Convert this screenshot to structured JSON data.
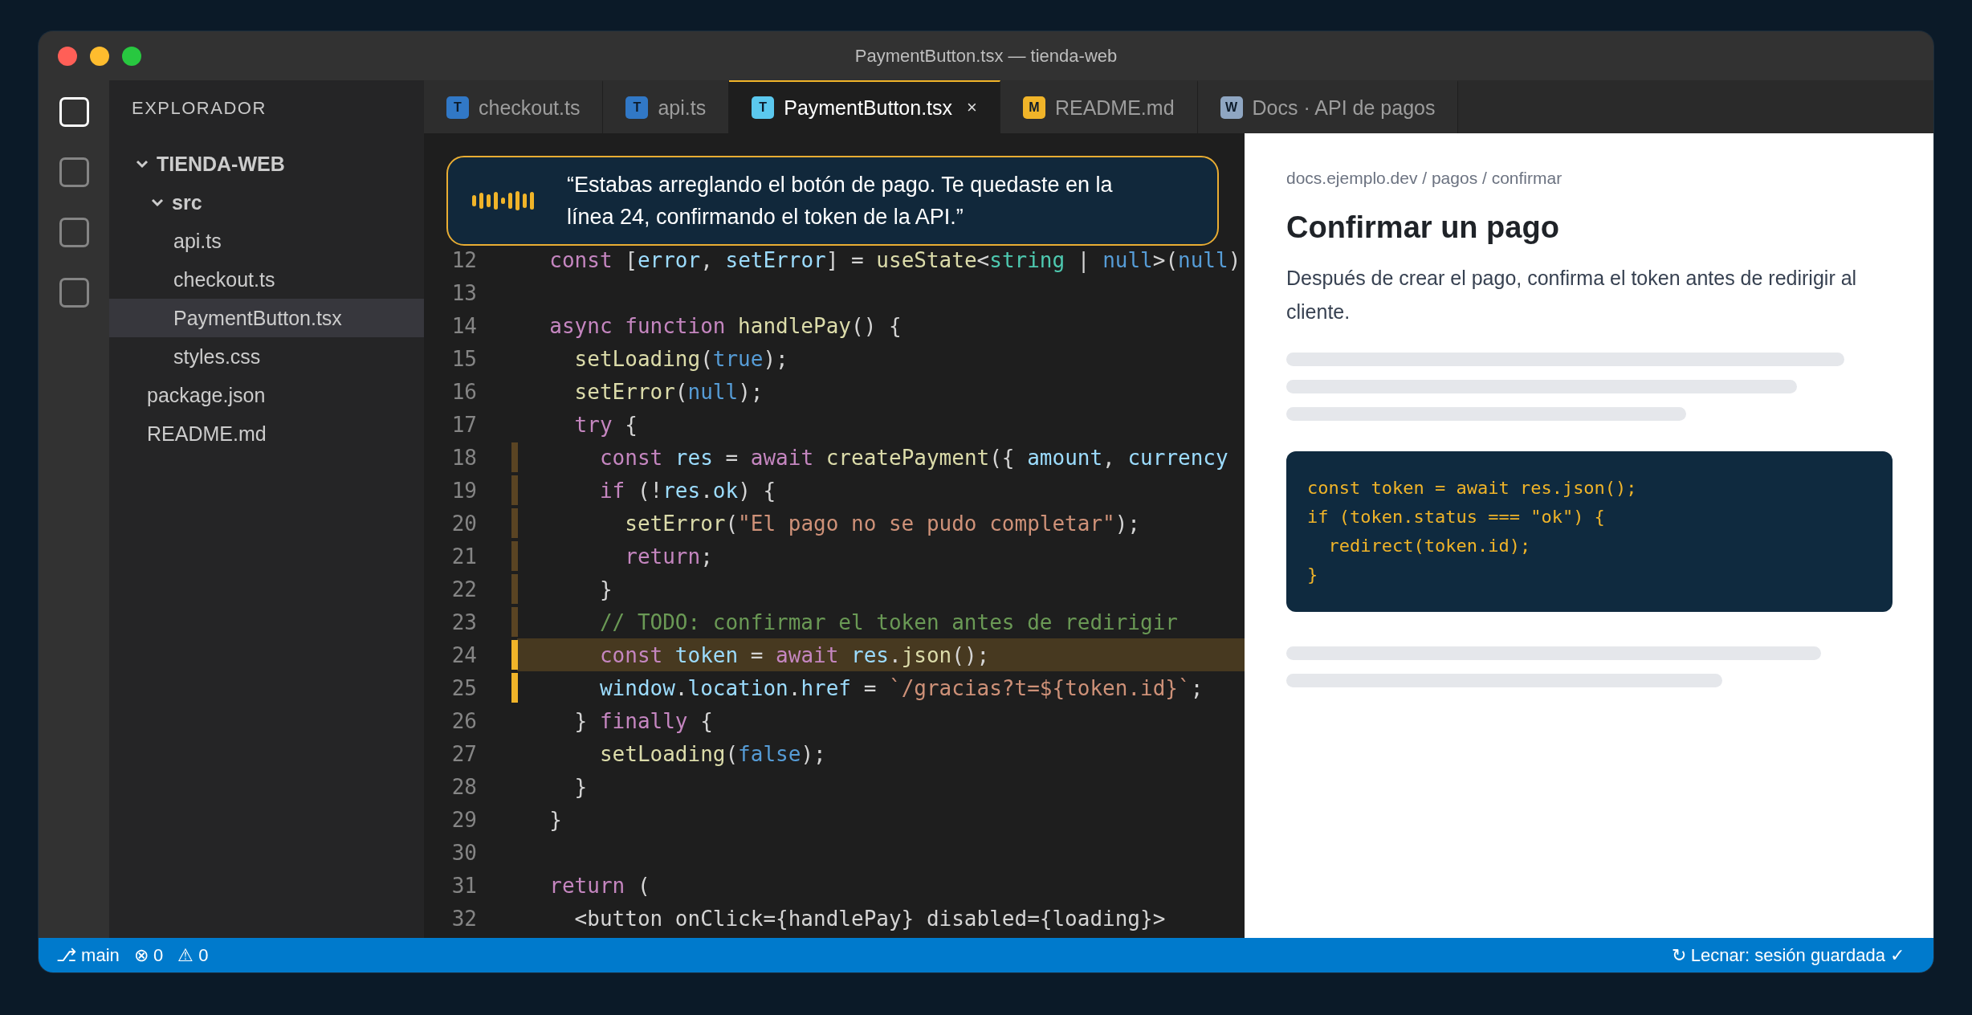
{
  "window": {
    "title": "PaymentButton.tsx — tienda-web"
  },
  "activity_bar": [
    {
      "selected": true
    },
    {
      "selected": false
    },
    {
      "selected": false
    },
    {
      "selected": false
    }
  ],
  "explorer": {
    "title": "EXPLORADOR",
    "tree": [
      {
        "label": "TIENDA-WEB",
        "kind": "folder",
        "expanded": true,
        "selected": false,
        "children": [
          {
            "label": "src",
            "kind": "folder",
            "expanded": true,
            "selected": false,
            "children": [
              {
                "label": "api.ts",
                "kind": "file",
                "selected": false
              },
              {
                "label": "checkout.ts",
                "kind": "file",
                "selected": false
              },
              {
                "label": "PaymentButton.tsx",
                "kind": "file",
                "selected": true
              },
              {
                "label": "styles.css",
                "kind": "file",
                "selected": false
              }
            ]
          },
          {
            "label": "package.json",
            "kind": "file",
            "selected": false
          },
          {
            "label": "README.md",
            "kind": "file",
            "selected": false
          }
        ]
      }
    ]
  },
  "tabs": [
    {
      "badge": "T",
      "color": "#3178c6",
      "label": "checkout.ts",
      "selected": false
    },
    {
      "badge": "T",
      "color": "#3178c6",
      "label": "api.ts",
      "selected": false
    },
    {
      "badge": "T",
      "color": "#5bc8ee",
      "label": "PaymentButton.tsx",
      "selected": true,
      "close": "×"
    },
    {
      "badge": "M",
      "color": "#f0b429",
      "label": "README.md",
      "selected": false
    },
    {
      "badge": "W",
      "color": "#8fa6c2",
      "label": "Docs · API de pagos",
      "selected": false
    }
  ],
  "tooltip": {
    "text": "“Estabas arreglando el botón de pago. Te quedaste en la línea 24, confirmando el token de la API.”"
  },
  "editor": {
    "lines": [
      {
        "number": "12",
        "kind": "plain",
        "highlighted": false,
        "tokens": [
          {
            "text": "  const",
            "kind": "kw"
          },
          {
            "text": " [",
            "kind": "plain"
          },
          {
            "text": "error",
            "kind": "var"
          },
          {
            "text": ", ",
            "kind": "plain"
          },
          {
            "text": "setError",
            "kind": "var"
          },
          {
            "text": "] = ",
            "kind": "plain"
          },
          {
            "text": "useState",
            "kind": "fn"
          },
          {
            "text": "<",
            "kind": "plain"
          },
          {
            "text": "string",
            "kind": "type"
          },
          {
            "text": " | ",
            "kind": "plain"
          },
          {
            "text": "null",
            "kind": "lit"
          },
          {
            "text": ">(",
            "kind": "plain"
          },
          {
            "text": "null",
            "kind": "lit"
          },
          {
            "text": ")",
            "kind": "plain"
          }
        ]
      },
      {
        "number": "13",
        "kind": "plain",
        "highlighted": false
      },
      {
        "number": "14",
        "kind": "plain",
        "highlighted": false,
        "tokens": [
          {
            "text": "  async function",
            "kind": "kw"
          },
          {
            "text": " handlePay",
            "kind": "fn"
          },
          {
            "text": "() {",
            "kind": "plain"
          }
        ]
      },
      {
        "number": "15",
        "kind": "plain",
        "highlighted": false,
        "tokens": [
          {
            "text": "    setLoading",
            "kind": "fn"
          },
          {
            "text": "(",
            "kind": "plain"
          },
          {
            "text": "true",
            "kind": "lit"
          },
          {
            "text": ");",
            "kind": "plain"
          }
        ]
      },
      {
        "number": "16",
        "kind": "plain",
        "highlighted": false,
        "tokens": [
          {
            "text": "    setError",
            "kind": "fn"
          },
          {
            "text": "(",
            "kind": "plain"
          },
          {
            "text": "null",
            "kind": "lit"
          },
          {
            "text": ");",
            "kind": "plain"
          }
        ]
      },
      {
        "number": "17",
        "kind": "plain",
        "highlighted": false,
        "tokens": [
          {
            "text": "    try",
            "kind": "kw"
          },
          {
            "text": " {",
            "kind": "plain"
          }
        ]
      },
      {
        "number": "18",
        "kind": "modified",
        "highlighted": false,
        "tokens": [
          {
            "text": "      const",
            "kind": "kw"
          },
          {
            "text": " res",
            "kind": "var"
          },
          {
            "text": " = ",
            "kind": "plain"
          },
          {
            "text": "await",
            "kind": "kw"
          },
          {
            "text": " createPayment",
            "kind": "fn"
          },
          {
            "text": "({ ",
            "kind": "plain"
          },
          {
            "text": "amount",
            "kind": "var"
          },
          {
            "text": ", ",
            "kind": "plain"
          },
          {
            "text": "currency",
            "kind": "var"
          }
        ]
      },
      {
        "number": "19",
        "kind": "modified",
        "highlighted": false,
        "tokens": [
          {
            "text": "      if",
            "kind": "kw"
          },
          {
            "text": " (!",
            "kind": "plain"
          },
          {
            "text": "res",
            "kind": "var"
          },
          {
            "text": ".",
            "kind": "plain"
          },
          {
            "text": "ok",
            "kind": "var"
          },
          {
            "text": ") {",
            "kind": "plain"
          }
        ]
      },
      {
        "number": "20",
        "kind": "modified",
        "highlighted": false,
        "tokens": [
          {
            "text": "        setError",
            "kind": "fn"
          },
          {
            "text": "(",
            "kind": "plain"
          },
          {
            "text": "\"El pago no se pudo completar\"",
            "kind": "str"
          },
          {
            "text": ");",
            "kind": "plain"
          }
        ]
      },
      {
        "number": "21",
        "kind": "modified",
        "highlighted": false,
        "tokens": [
          {
            "text": "        return",
            "kind": "kw"
          },
          {
            "text": ";",
            "kind": "plain"
          }
        ]
      },
      {
        "number": "22",
        "kind": "modified",
        "highlighted": false,
        "tokens": [
          {
            "text": "      }",
            "kind": "plain"
          }
        ]
      },
      {
        "number": "23",
        "kind": "modified",
        "highlighted": false,
        "tokens": [
          {
            "text": "      // TODO: confirmar el token antes de redirigir",
            "kind": "cm"
          }
        ]
      },
      {
        "number": "24",
        "kind": "current",
        "highlighted": true,
        "tokens": [
          {
            "text": "      const",
            "kind": "kw"
          },
          {
            "text": " token",
            "kind": "var"
          },
          {
            "text": " = ",
            "kind": "plain"
          },
          {
            "text": "await",
            "kind": "kw"
          },
          {
            "text": " res",
            "kind": "var"
          },
          {
            "text": ".",
            "kind": "plain"
          },
          {
            "text": "json",
            "kind": "fn"
          },
          {
            "text": "();",
            "kind": "plain"
          }
        ]
      },
      {
        "number": "25",
        "kind": "current",
        "highlighted": false,
        "tokens": [
          {
            "text": "      window",
            "kind": "var"
          },
          {
            "text": ".",
            "kind": "plain"
          },
          {
            "text": "location",
            "kind": "var"
          },
          {
            "text": ".",
            "kind": "plain"
          },
          {
            "text": "href",
            "kind": "var"
          },
          {
            "text": " = ",
            "kind": "plain"
          },
          {
            "text": "`/gracias?t=${token.id}`",
            "kind": "str"
          },
          {
            "text": ";",
            "kind": "plain"
          }
        ]
      },
      {
        "number": "26",
        "kind": "plain",
        "highlighted": false,
        "tokens": [
          {
            "text": "    } ",
            "kind": "plain"
          },
          {
            "text": "finally",
            "kind": "kw"
          },
          {
            "text": " {",
            "kind": "plain"
          }
        ]
      },
      {
        "number": "27",
        "kind": "plain",
        "highlighted": false,
        "tokens": [
          {
            "text": "      setLoading",
            "kind": "fn"
          },
          {
            "text": "(",
            "kind": "plain"
          },
          {
            "text": "false",
            "kind": "lit"
          },
          {
            "text": ");",
            "kind": "plain"
          }
        ]
      },
      {
        "number": "28",
        "kind": "plain",
        "highlighted": false,
        "tokens": [
          {
            "text": "    }",
            "kind": "plain"
          }
        ]
      },
      {
        "number": "29",
        "kind": "plain",
        "highlighted": false,
        "tokens": [
          {
            "text": "  }",
            "kind": "plain"
          }
        ]
      },
      {
        "number": "30",
        "kind": "plain",
        "highlighted": false
      },
      {
        "number": "31",
        "kind": "plain",
        "highlighted": false,
        "tokens": [
          {
            "text": "  return",
            "kind": "kw"
          },
          {
            "text": " (",
            "kind": "plain"
          }
        ]
      },
      {
        "number": "32",
        "kind": "plain",
        "highlighted": false,
        "tokens": [
          {
            "text": "    <button onClick={handlePay} disabled={loading}>",
            "kind": "plain"
          }
        ]
      }
    ]
  },
  "docs": {
    "breadcrumb": "docs.ejemplo.dev / pagos / confirmar",
    "heading": "Confirmar un pago",
    "paragraph": "Después de crear el pago, confirma el token antes de redirigir al cliente.",
    "code": [
      "const token = await res.json();",
      "if (token.status === \"ok\") {",
      "  redirect(token.id);",
      "}"
    ]
  },
  "status_bar": {
    "branch": "⎇ main",
    "errors": "⊗ 0",
    "warnings": "⚠ 0",
    "session": "↻ Lecnar: sesión guardada ✓"
  }
}
